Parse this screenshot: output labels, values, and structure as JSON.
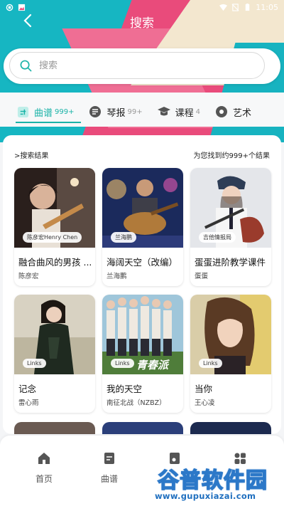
{
  "status_bar": {
    "time": "11:05"
  },
  "header": {
    "title": "搜索"
  },
  "search": {
    "placeholder": "搜索"
  },
  "tabs": [
    {
      "label": "曲谱",
      "count": "999+",
      "icon": "score-icon",
      "active": true
    },
    {
      "label": "琴报",
      "count": "99+",
      "icon": "newspaper-icon",
      "active": false
    },
    {
      "label": "课程",
      "count": "4",
      "icon": "graduation-cap-icon",
      "active": false
    },
    {
      "label": "艺术",
      "count": "",
      "icon": "art-icon",
      "active": false
    }
  ],
  "results": {
    "heading": ">搜索结果",
    "summary": "为您找到约999+个结果",
    "cards": [
      {
        "tag": "陈彦宏Henry Chen",
        "title": "融合曲风的男孩 ...",
        "author": "陈彦宏"
      },
      {
        "tag": "兰海鹏",
        "title": "海阔天空（改编）",
        "author": "兰海鹏"
      },
      {
        "tag": "吉他情报局",
        "title": "蛋蛋进阶教学课件",
        "author": "蛋蛋"
      },
      {
        "tag": "Links",
        "title": "记念",
        "author": "雷心雨"
      },
      {
        "tag": "Links",
        "title": "我的天空",
        "author": "南征北战（NZBZ）"
      },
      {
        "tag": "Links",
        "title": "当你",
        "author": "王心凌"
      }
    ],
    "poster_text": "青春派"
  },
  "bottom_nav": [
    {
      "label": "首页",
      "icon": "home-icon"
    },
    {
      "label": "曲谱",
      "icon": "score-icon"
    },
    {
      "label": "",
      "icon": "music-icon"
    },
    {
      "label": "",
      "icon": "grid-icon"
    }
  ],
  "watermark": {
    "brand": "谷普软件园",
    "url": "www.gupuxiazai.com"
  },
  "colors": {
    "accent": "#1bb3a8",
    "hero_pink": "#e94b7b",
    "hero_teal": "#16b6c2"
  }
}
